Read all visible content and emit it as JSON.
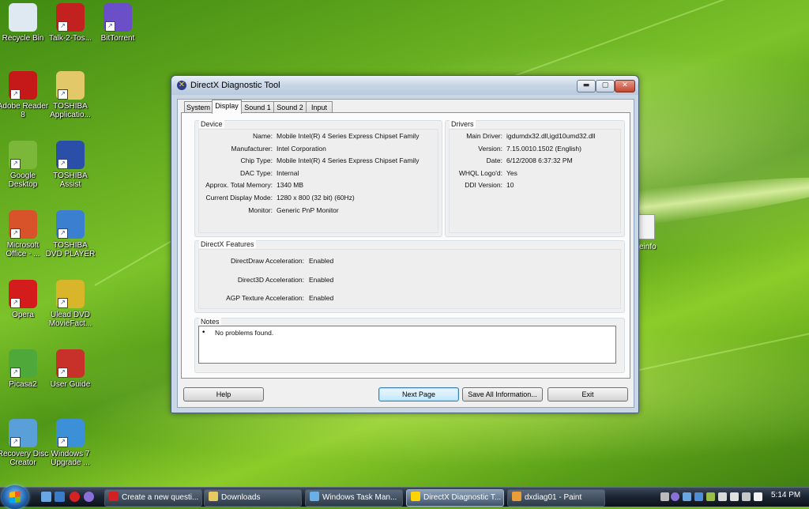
{
  "desktop": {
    "icons": [
      {
        "label": "Recycle Bin"
      },
      {
        "label": "Talk-2-Tos..."
      },
      {
        "label": "BitTorrent"
      },
      {
        "label": "Adobe Reader 8"
      },
      {
        "label": "TOSHIBA Applicatio..."
      },
      {
        "label": "Google Desktop"
      },
      {
        "label": "TOSHIBA Assist"
      },
      {
        "label": "Microsoft Office - ..."
      },
      {
        "label": "TOSHIBA DVD PLAYER"
      },
      {
        "label": "Opera"
      },
      {
        "label": "Ulead DVD MovieFact..."
      },
      {
        "label": "Picasa2"
      },
      {
        "label": "User Guide"
      },
      {
        "label": "Recovery Disc Creator"
      },
      {
        "label": "Windows 7 Upgrade ..."
      }
    ],
    "partial_icon_label": "einfo"
  },
  "window": {
    "title": "DirectX Diagnostic Tool",
    "title_buttons": {
      "minimize": "▬",
      "maximize": "▢",
      "close": "✕"
    },
    "tabs": [
      "System",
      "Display",
      "Sound 1",
      "Sound 2",
      "Input"
    ],
    "active_tab": "Display",
    "device": {
      "title": "Device",
      "rows": [
        {
          "label": "Name:",
          "value": "Mobile Intel(R) 4 Series Express Chipset Family"
        },
        {
          "label": "Manufacturer:",
          "value": "Intel Corporation"
        },
        {
          "label": "Chip Type:",
          "value": "Mobile Intel(R) 4 Series Express Chipset Family"
        },
        {
          "label": "DAC Type:",
          "value": "Internal"
        },
        {
          "label": "Approx. Total Memory:",
          "value": "1340 MB"
        },
        {
          "label": "Current Display Mode:",
          "value": "1280 x 800 (32 bit) (60Hz)"
        },
        {
          "label": "Monitor:",
          "value": "Generic PnP Monitor"
        }
      ]
    },
    "drivers": {
      "title": "Drivers",
      "rows": [
        {
          "label": "Main Driver:",
          "value": "igdumdx32.dll,igd10umd32.dll"
        },
        {
          "label": "Version:",
          "value": "7.15.0010.1502 (English)"
        },
        {
          "label": "Date:",
          "value": "6/12/2008 6:37:32 PM"
        },
        {
          "label": "WHQL Logo'd:",
          "value": "Yes"
        },
        {
          "label": "DDI Version:",
          "value": "10"
        }
      ]
    },
    "features": {
      "title": "DirectX Features",
      "rows": [
        {
          "label": "DirectDraw Acceleration:",
          "value": "Enabled"
        },
        {
          "label": "Direct3D Acceleration:",
          "value": "Enabled"
        },
        {
          "label": "AGP Texture Acceleration:",
          "value": "Enabled"
        }
      ]
    },
    "notes": {
      "title": "Notes",
      "bullet": "•",
      "items": [
        "No problems found."
      ]
    },
    "buttons": {
      "help": "Help",
      "next_page": "Next Page",
      "save_all": "Save All Information...",
      "exit": "Exit"
    }
  },
  "taskbar": {
    "items": [
      {
        "label": "Create a new questi...",
        "color": "#d32020"
      },
      {
        "label": "Downloads",
        "color": "#e8c860"
      },
      {
        "label": "Windows Task Man...",
        "color": "#6ab0e8"
      },
      {
        "label": "DirectX Diagnostic T...",
        "color": "#ffd400"
      },
      {
        "label": "dxdiag01 - Paint",
        "color": "#e89c3a"
      }
    ],
    "active_item": "DirectX Diagnostic T...",
    "clock": "5:14 PM"
  },
  "colors": {
    "desktop_green": "#5ea51c",
    "window_frame": "#c9d6e6",
    "close_button": "#c3452e"
  }
}
